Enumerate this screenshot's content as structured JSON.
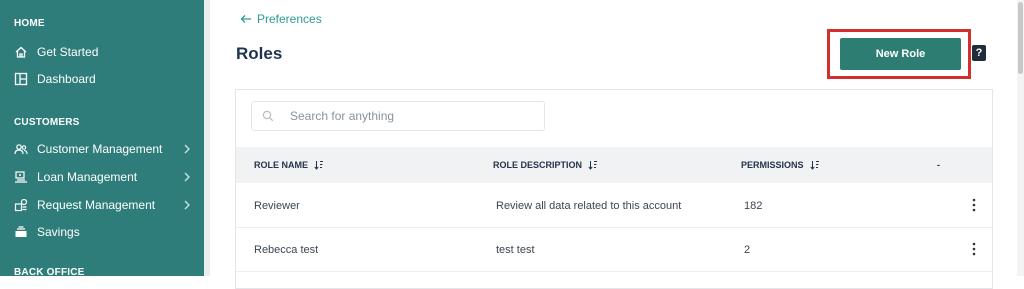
{
  "sidebar": {
    "sections": [
      {
        "title": "HOME"
      },
      {
        "title": "CUSTOMERS"
      },
      {
        "title": "BACK OFFICE"
      }
    ],
    "items": [
      {
        "label": "Get Started",
        "icon": "home-icon"
      },
      {
        "label": "Dashboard",
        "icon": "dashboard-icon"
      },
      {
        "label": "Customer Management",
        "icon": "users-icon"
      },
      {
        "label": "Loan Management",
        "icon": "loan-icon"
      },
      {
        "label": "Request Management",
        "icon": "request-icon"
      },
      {
        "label": "Savings",
        "icon": "savings-icon"
      }
    ]
  },
  "header": {
    "back_label": "Preferences",
    "title": "Roles",
    "new_role_label": "New Role",
    "help_label": "?"
  },
  "search": {
    "placeholder": "Search for anything"
  },
  "table": {
    "columns": [
      "ROLE NAME",
      "ROLE DESCRIPTION",
      "PERMISSIONS",
      "-"
    ],
    "rows": [
      {
        "name": "Reviewer",
        "description": "Review all data related to this account",
        "permissions": "182"
      },
      {
        "name": "Rebecca test",
        "description": "test test",
        "permissions": "2"
      }
    ]
  },
  "colors": {
    "sidebar": "#2e7d7a",
    "accent": "#2e7d72",
    "highlight": "#d32f2f",
    "link": "#2e9c94"
  }
}
